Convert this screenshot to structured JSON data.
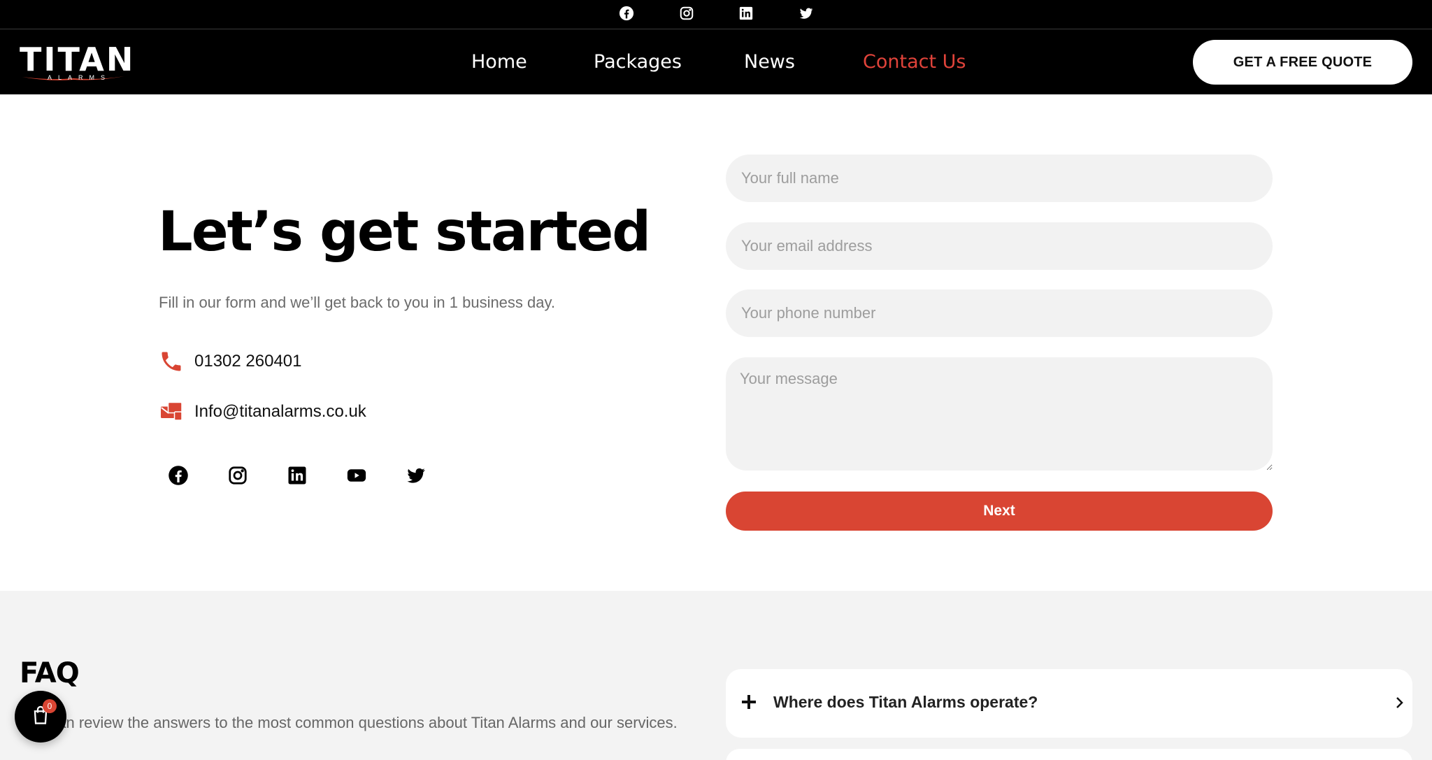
{
  "topbar": {
    "social_icons": [
      "facebook-icon",
      "instagram-icon",
      "linkedin-icon",
      "twitter-icon"
    ]
  },
  "header": {
    "logo_text": "TITAN",
    "logo_subtext": "ALARMS",
    "nav": [
      {
        "label": "Home",
        "active": false
      },
      {
        "label": "Packages",
        "active": false
      },
      {
        "label": "News",
        "active": false
      },
      {
        "label": "Contact Us",
        "active": true
      }
    ],
    "cta_label": "GET A FREE QUOTE"
  },
  "intro": {
    "headline": "Let’s get started",
    "lead": "Fill in our form and we’ll get back to you in 1 business day.",
    "phone": "01302 260401",
    "email": "Info@titanalarms.co.uk",
    "social_icons": [
      "facebook-icon",
      "instagram-icon",
      "linkedin-icon",
      "youtube-icon",
      "twitter-icon"
    ]
  },
  "form": {
    "name_placeholder": "Your full name",
    "email_placeholder": "Your email address",
    "phone_placeholder": "Your phone number",
    "message_placeholder": "Your message",
    "submit_label": "Next"
  },
  "faq": {
    "title": "FAQ",
    "description": "You can review the answers to the most common questions about Titan Alarms and our services.",
    "items": [
      {
        "question": "Where does Titan Alarms operate?"
      }
    ]
  },
  "cart": {
    "count": "0"
  },
  "colors": {
    "accent": "#d94533",
    "nav_active": "#e0433a",
    "header_bg": "#000000",
    "field_bg": "#f2f2f2",
    "faq_bg": "#f3f3f3"
  }
}
